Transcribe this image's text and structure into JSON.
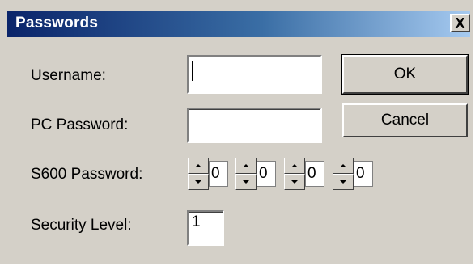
{
  "window": {
    "title": "Passwords",
    "close_glyph": "X"
  },
  "fields": {
    "username": {
      "label": "Username:",
      "value": ""
    },
    "pc_password": {
      "label": "PC Password:",
      "value": ""
    },
    "s600_password": {
      "label": "S600 Password:",
      "digits": [
        "0",
        "0",
        "0",
        "0"
      ]
    },
    "security_level": {
      "label": "Security Level:",
      "value": "1"
    }
  },
  "buttons": {
    "ok": "OK",
    "cancel": "Cancel"
  },
  "colors": {
    "dialog_bg": "#d4d0c8",
    "titlebar_start": "#0a246a",
    "titlebar_end": "#a6caf0"
  }
}
